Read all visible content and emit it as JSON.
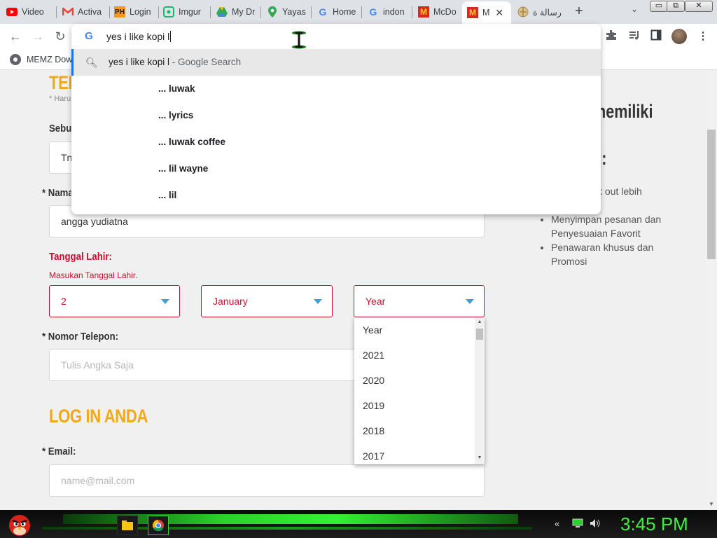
{
  "tabs": [
    {
      "title": "Video",
      "icon": "youtube-icon",
      "color": "#ff0000"
    },
    {
      "title": "Activa",
      "icon": "gmail-icon",
      "color": "#ea4335"
    },
    {
      "title": "Login",
      "icon": "ph-icon",
      "label": "PH",
      "color": "#f7971d"
    },
    {
      "title": "Imgur",
      "icon": "imgur-icon",
      "color": "#1bb76e"
    },
    {
      "title": "My Dr",
      "icon": "google-drive-icon",
      "color": "#1a73e8"
    },
    {
      "title": "Yayas",
      "icon": "maps-pin-icon",
      "color": "#34a853"
    },
    {
      "title": "Home",
      "icon": "google-icon",
      "color": "#4285f4"
    },
    {
      "title": "indon",
      "icon": "google-icon",
      "color": "#4285f4"
    },
    {
      "title": "McDo",
      "icon": "mcdonalds-icon",
      "color": "#da291c"
    },
    {
      "title": "M",
      "icon": "mcdonalds-icon",
      "color": "#da291c",
      "active": true
    },
    {
      "title": "رسالة ة",
      "icon": "globe-icon",
      "color": "#a88b4a"
    }
  ],
  "window_controls": {
    "minimize": "▭",
    "restore": "⧉",
    "close": "✕"
  },
  "omnibox": {
    "query": "yes i like kopi l",
    "suggestions": [
      {
        "text": "yes i like kopi l",
        "suffix": " - Google Search",
        "highlighted": true
      },
      {
        "prefix": "...",
        "tail": "luwak"
      },
      {
        "prefix": "...",
        "tail": "lyrics"
      },
      {
        "prefix": "...",
        "tail": "luwak coffee"
      },
      {
        "prefix": "...",
        "tail": "lil wayne"
      },
      {
        "prefix": "...",
        "tail": "lil"
      }
    ]
  },
  "bookmarks": [
    {
      "label": "MEMZ Dow",
      "icon": "chrome-icon"
    }
  ],
  "form": {
    "section_title": "TEN",
    "required_note": "* Haru",
    "name_label": "Sebut",
    "name_value_partial": "Tn",
    "fullname_label": "* Nama",
    "fullname_value": "angga yudiatna",
    "dob_label": "Tanggal Lahir:",
    "dob_hint": "Masukan Tanggal Lahir.",
    "day_value": "2",
    "month_value": "January",
    "year_value": "Year",
    "phone_label": "* Nomor Telepon:",
    "phone_placeholder": "Tulis Angka Saja",
    "login_title": "LOG IN ANDA",
    "email_label": "* Email:",
    "email_placeholder": "name@mail.com"
  },
  "year_options": [
    "Year",
    "2021",
    "2020",
    "2019",
    "2018",
    "2017"
  ],
  "sidebar": {
    "heading_partial": "memiliki",
    "subheading_partial": "n:",
    "text_partial": "ck out lebih",
    "benefits": [
      "Menyimpan pesanan dan Penyesuaian Favorit",
      "Penawaran khusus dan Promosi"
    ]
  },
  "taskbar": {
    "clock": "3:45 PM"
  }
}
